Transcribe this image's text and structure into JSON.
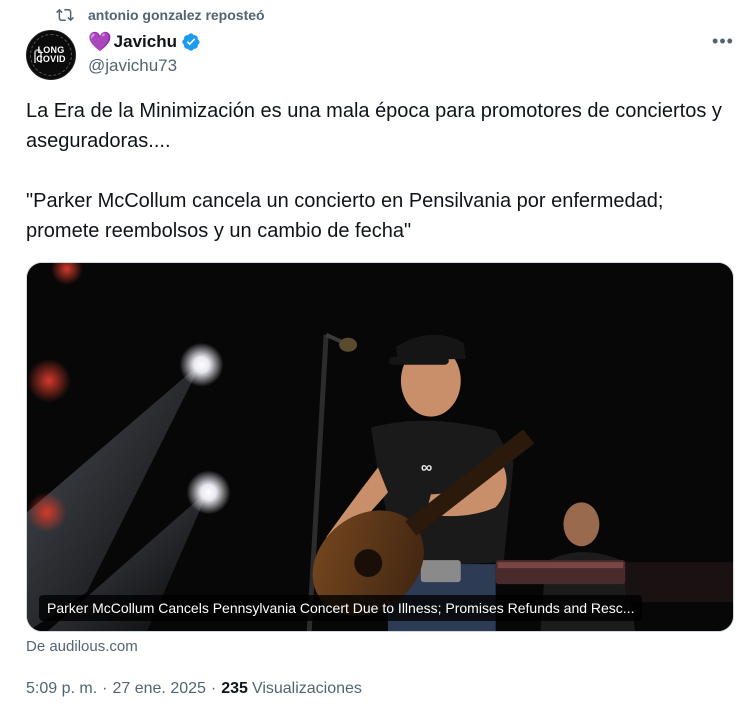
{
  "repost": {
    "text": "antonio gonzalez reposteó"
  },
  "author": {
    "emoji": "💜",
    "display_name": "Javichu",
    "handle": "@javichu73",
    "avatar_text": [
      "LONG",
      "COVID"
    ],
    "verified": true
  },
  "tweet": {
    "paragraph1": "La Era de la Minimización es una mala época para promotores de conciertos y aseguradoras....",
    "paragraph2": "\"Parker McCollum cancela un concierto en Pensilvania por enfermedad; promete reembolsos y un cambio de fecha\""
  },
  "card": {
    "caption": "Parker McCollum Cancels Pennsylvania Concert Due to Illness; Promises Refunds and Resc...",
    "source": "De audilous.com"
  },
  "meta": {
    "time": "5:09 p. m.",
    "separator": "·",
    "date": "27 ene. 2025",
    "views_count": "235",
    "views_label": "Visualizaciones"
  },
  "icons": {
    "repost": "repost-icon",
    "verified": "verified-badge-icon",
    "more": "more-options-icon"
  },
  "colors": {
    "verified_blue": "#1d9bf0",
    "secondary_text": "#536471",
    "primary_text": "#0f1419"
  }
}
